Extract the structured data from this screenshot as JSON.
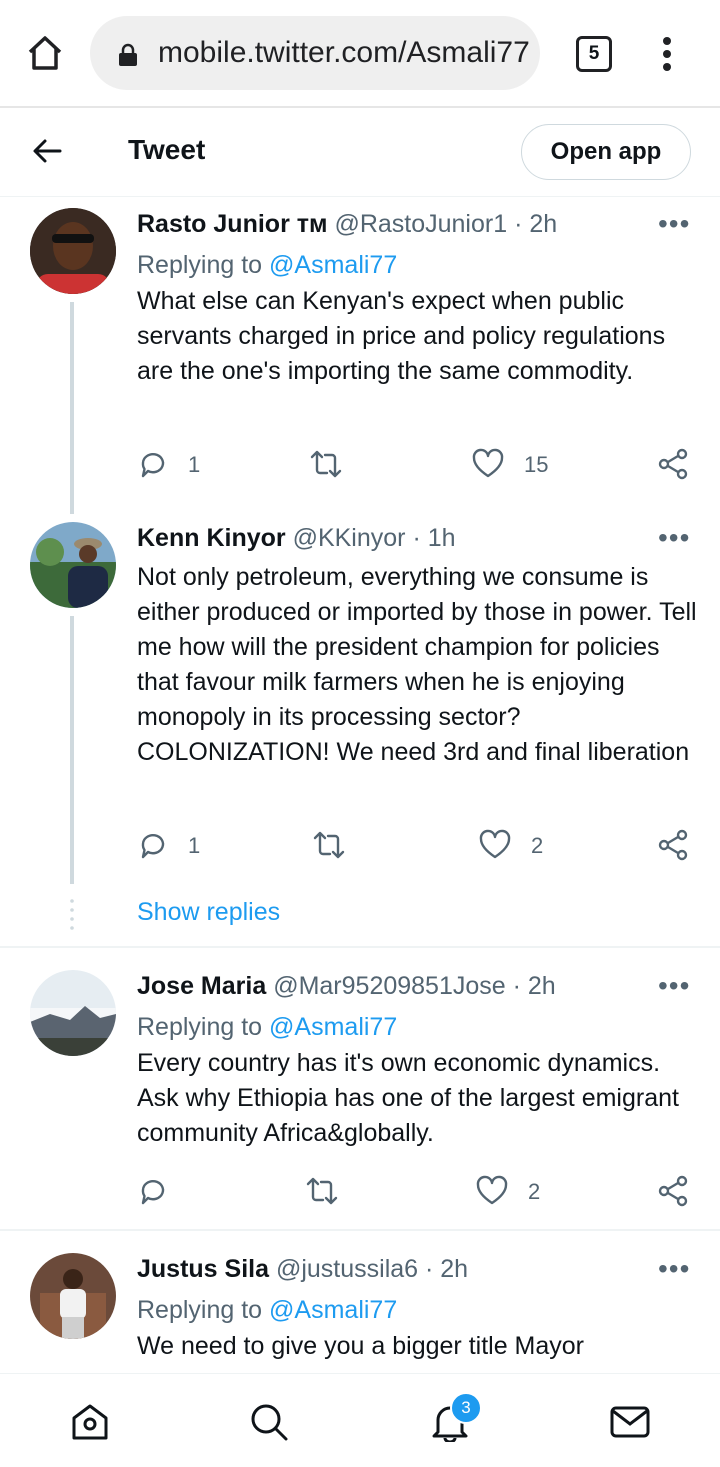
{
  "browser": {
    "url": "mobile.twitter.com/Asmali77",
    "tab_count": "5"
  },
  "header": {
    "title": "Tweet",
    "open_app_label": "Open app"
  },
  "tweets": [
    {
      "name": "Rasto Junior ᴛᴍ",
      "handle": "@RastoJunior1 · 2h",
      "replying_prefix": "Replying to ",
      "replying_to": "@Asmali77",
      "text": "What else can Kenyan's expect when public servants charged in price and policy regulations are the one's importing the same commodity.",
      "replies": "1",
      "retweets": "",
      "likes": "15"
    },
    {
      "name": "Kenn Kinyor",
      "handle": "@KKinyor · 1h",
      "text": "Not only petroleum, everything we consume is either produced or imported by those in power. Tell me how will the president champion for policies that favour milk farmers when he is enjoying monopoly in its processing sector? COLONIZATION!  We need 3rd and final liberation",
      "replies": "1",
      "retweets": "",
      "likes": "2"
    },
    {
      "name": "Jose Maria",
      "handle": "@Mar95209851Jose · 2h",
      "replying_prefix": "Replying to ",
      "replying_to": "@Asmali77",
      "text": "Every country has it's own economic dynamics. Ask why Ethiopia has one of the largest emigrant community Africa&globally.",
      "replies": "",
      "retweets": "",
      "likes": "2"
    },
    {
      "name": "Justus Sila",
      "handle": "@justussila6 · 2h",
      "replying_prefix": "Replying to ",
      "replying_to": "@Asmali77",
      "text": "We need to give you a bigger title Mayor"
    }
  ],
  "show_replies_label": "Show replies",
  "nav": {
    "notifications_badge": "3"
  },
  "icons": [
    "home-icon",
    "lock-icon",
    "tabs-icon",
    "menu-icon",
    "back-arrow-icon",
    "more-icon",
    "reply-icon",
    "retweet-icon",
    "like-icon",
    "share-icon",
    "search-icon",
    "bell-icon",
    "mail-icon"
  ],
  "colors": {
    "accent": "#1d9bf0",
    "text": "#0f1419",
    "secondary": "#536471"
  }
}
